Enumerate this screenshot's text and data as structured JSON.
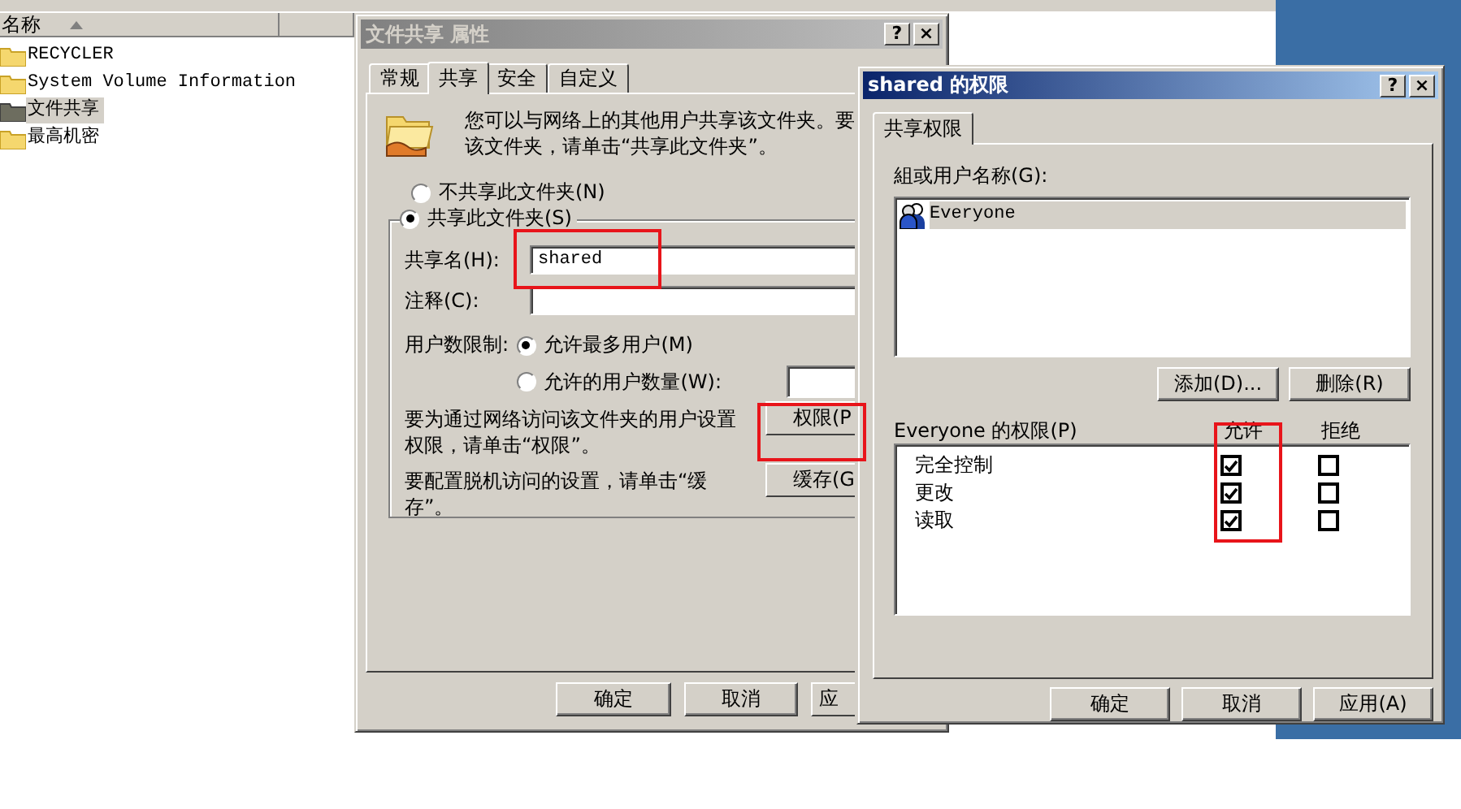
{
  "explorer": {
    "column_header": "名称",
    "items": [
      {
        "label": "RECYCLER",
        "selected": false
      },
      {
        "label": "System Volume Information",
        "selected": false
      },
      {
        "label": "文件共享",
        "selected": true
      },
      {
        "label": "最高机密",
        "selected": false
      }
    ]
  },
  "properties_dialog": {
    "title": "文件共享 属性",
    "active": false,
    "title_buttons": [
      "?",
      "×"
    ],
    "tabs": [
      {
        "label": "常规",
        "selected": false
      },
      {
        "label": "共享",
        "selected": true
      },
      {
        "label": "安全",
        "selected": false
      },
      {
        "label": "自定义",
        "selected": false
      }
    ],
    "intro_lines": [
      "您可以与网络上的其他用户共享该文件夹。要",
      "该文件夹，请单击“共享此文件夹”。"
    ],
    "share_options": [
      {
        "label": "不共享此文件夹(N)",
        "selected": false
      },
      {
        "label": "共享此文件夹(S)",
        "selected": true
      }
    ],
    "share_name": {
      "label": "共享名(H):",
      "value": "shared"
    },
    "comment": {
      "label": "注释(C):"
    },
    "user_limit": {
      "label": "用户数限制:",
      "options": [
        {
          "label": "允许最多用户(M)",
          "selected": true
        },
        {
          "label": "允许的用户数量(W):",
          "selected": false
        }
      ]
    },
    "permissions_hint": "要为通过网络访问该文件夹的用户设置权限，请单击“权限”。",
    "permissions_button": "权限(P",
    "offline_hint": "要配置脱机访问的设置，请单击“缓存”。",
    "caching_button": "缓存(G",
    "buttons": [
      "确定",
      "取消",
      "应"
    ]
  },
  "permissions_dialog": {
    "title": "shared 的权限",
    "active": true,
    "title_buttons": [
      "?",
      "×"
    ],
    "tabs": [
      {
        "label": "共享权限",
        "selected": true
      }
    ],
    "group_label": "組或用户名称(G):",
    "principals": [
      {
        "name": "Everyone",
        "selected": true
      }
    ],
    "list_buttons": [
      "添加(D)...",
      "删除(R)"
    ],
    "permissions_label": "Everyone 的权限(P)",
    "columns": [
      "允许",
      "拒绝"
    ],
    "permissions": [
      {
        "name": "完全控制",
        "allow": true,
        "deny": false
      },
      {
        "name": "更改",
        "allow": true,
        "deny": false
      },
      {
        "name": "读取",
        "allow": true,
        "deny": false
      }
    ],
    "buttons": [
      "确定",
      "取消",
      "应用(A)"
    ]
  }
}
